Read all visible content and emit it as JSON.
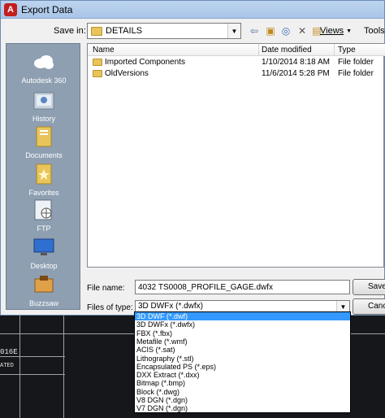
{
  "window": {
    "title": "Export Data",
    "title_icon": "A"
  },
  "toolbar": {
    "savein_label": "Save in:",
    "current_folder": "DETAILS",
    "views_label": "Views",
    "tools_label": "Tools"
  },
  "places": [
    {
      "label": "Autodesk 360",
      "icon": "cloud-icon"
    },
    {
      "label": "History",
      "icon": "history-icon"
    },
    {
      "label": "Documents",
      "icon": "documents-icon"
    },
    {
      "label": "Favorites",
      "icon": "favorites-icon"
    },
    {
      "label": "FTP",
      "icon": "ftp-icon"
    },
    {
      "label": "Desktop",
      "icon": "desktop-icon"
    },
    {
      "label": "Buzzsaw",
      "icon": "buzzsaw-icon"
    }
  ],
  "filelist": {
    "columns": {
      "name": "Name",
      "date": "Date modified",
      "type": "Type"
    },
    "rows": [
      {
        "name": "Imported Components",
        "date": "1/10/2014 8:18 AM",
        "type": "File folder"
      },
      {
        "name": "OldVersions",
        "date": "11/6/2014 5:28 PM",
        "type": "File folder"
      }
    ]
  },
  "filename": {
    "label": "File name:",
    "value": "4032 TS0008_PROFILE_GAGE.dwfx"
  },
  "filetype": {
    "label": "Files of type:",
    "selected": "3D DWFx (*.dwfx)",
    "options": [
      "3D DWF (*.dwf)",
      "3D DWFx (*.dwfx)",
      "FBX (*.fbx)",
      "Metafile (*.wmf)",
      "ACIS (*.sat)",
      "Lithography (*.stl)",
      "Encapsulated PS (*.eps)",
      "DXX Extract (*.dxx)",
      "Bitmap (*.bmp)",
      "Block (*.dwg)",
      "V8 DGN (*.dgn)",
      "V7 DGN (*.dgn)"
    ],
    "highlighted_index": 0
  },
  "buttons": {
    "save": "Save",
    "cancel": "Cance"
  },
  "cad": {
    "label_1": "016E",
    "label_2": "ATED"
  },
  "colors": {
    "selection": "#3399ff",
    "places_bg": "#8e9fb2",
    "title_icon": "#c21f1f"
  }
}
